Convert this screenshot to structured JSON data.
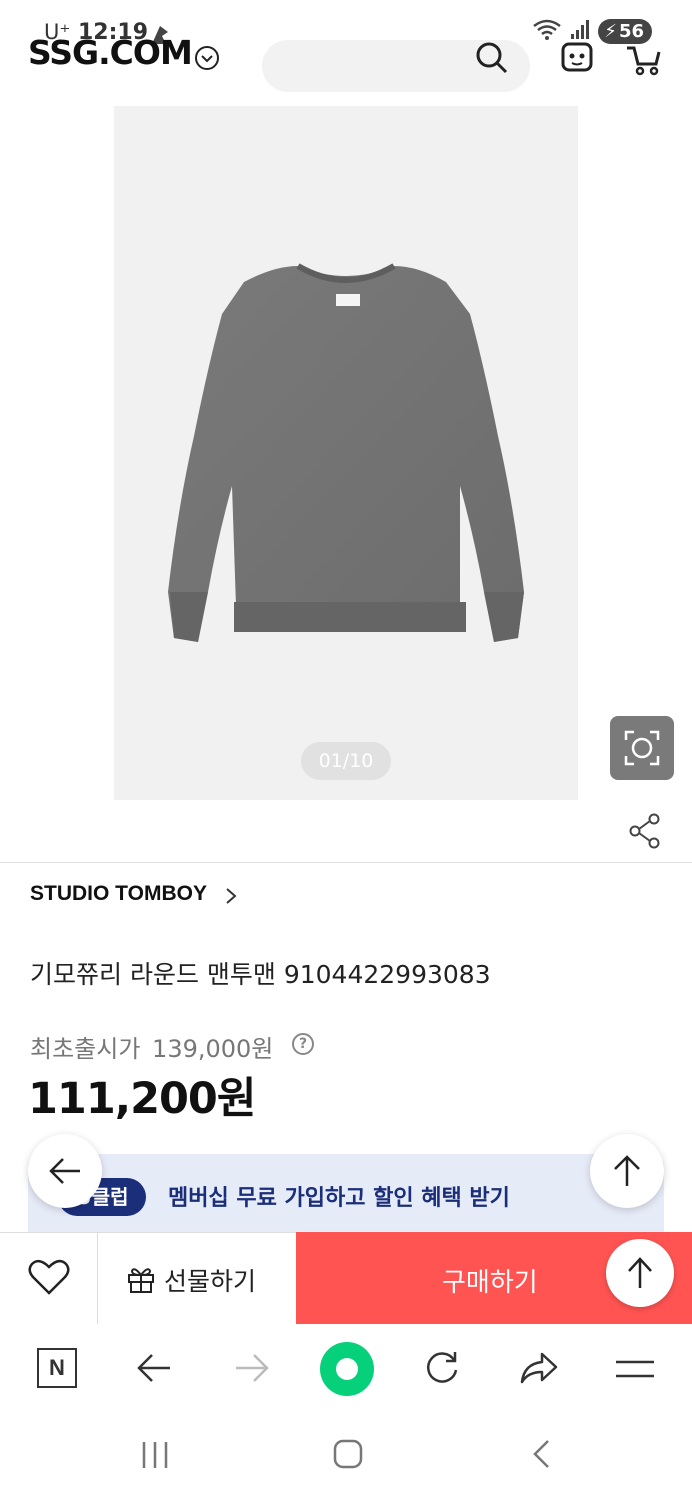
{
  "status_bar": {
    "carrier": "U⁺",
    "time": "12:19",
    "battery": "56"
  },
  "header": {
    "logo": "SSG.COM"
  },
  "gallery": {
    "counter": "01/10"
  },
  "product": {
    "brand": "STUDIO TOMBOY",
    "name": "기모쮸리 라운드 맨투맨 9104422993083",
    "original_price_label": "최초출시가",
    "original_price": "139,000원",
    "sale_price": "111,200원"
  },
  "banner": {
    "badge": "U클럽",
    "text": "멤버십 무료 가입하고 할인 혜택 받기"
  },
  "actions": {
    "gift_label": "선물하기",
    "buy_label": "구매하기"
  },
  "browser": {
    "n_label": "N"
  },
  "colors": {
    "buy_button": "#ff5452",
    "uclub_navy": "#1b2e7a",
    "banner_bg": "#e6ebf8",
    "naver_green": "#06d17a"
  }
}
